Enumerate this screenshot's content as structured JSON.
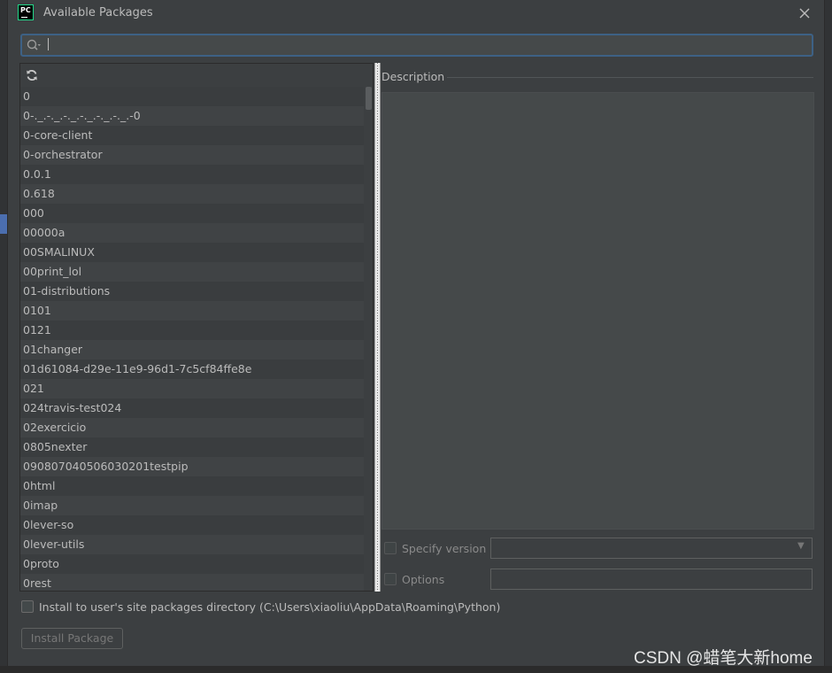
{
  "window": {
    "title": "Available Packages",
    "logo_text": "PC"
  },
  "search": {
    "placeholder": "",
    "value": ""
  },
  "packages": [
    "0",
    "0-._.-._.-._.-._.-._.-._.-0",
    "0-core-client",
    "0-orchestrator",
    "0.0.1",
    "0.618",
    "000",
    "00000a",
    "00SMALINUX",
    "00print_lol",
    "01-distributions",
    "0101",
    "0121",
    "01changer",
    "01d61084-d29e-11e9-96d1-7c5cf84ffe8e",
    "021",
    "024travis-test024",
    "02exercicio",
    "0805nexter",
    "090807040506030201testpip",
    "0html",
    "0imap",
    "0lever-so",
    "0lever-utils",
    "0proto",
    "0rest"
  ],
  "description": {
    "label": "Description",
    "text": ""
  },
  "specify_version": {
    "label": "Specify version",
    "checked": false,
    "value": ""
  },
  "options": {
    "label": "Options",
    "checked": false,
    "value": ""
  },
  "install_site": {
    "label": "Install to user's site packages directory (C:\\Users\\xiaoliu\\AppData\\Roaming\\Python)",
    "checked": false
  },
  "install_button": {
    "label": "Install Package",
    "enabled": false
  },
  "watermark": "CSDN @蜡笔大新home",
  "icons": [
    "pycharm-logo-icon",
    "close-icon",
    "search-icon",
    "refresh-icon",
    "chevron-down-icon"
  ],
  "colors": {
    "background": "#3c3f41",
    "text": "#bbbbbb",
    "focus_border": "#3d6185",
    "brand_green": "#21d789"
  }
}
